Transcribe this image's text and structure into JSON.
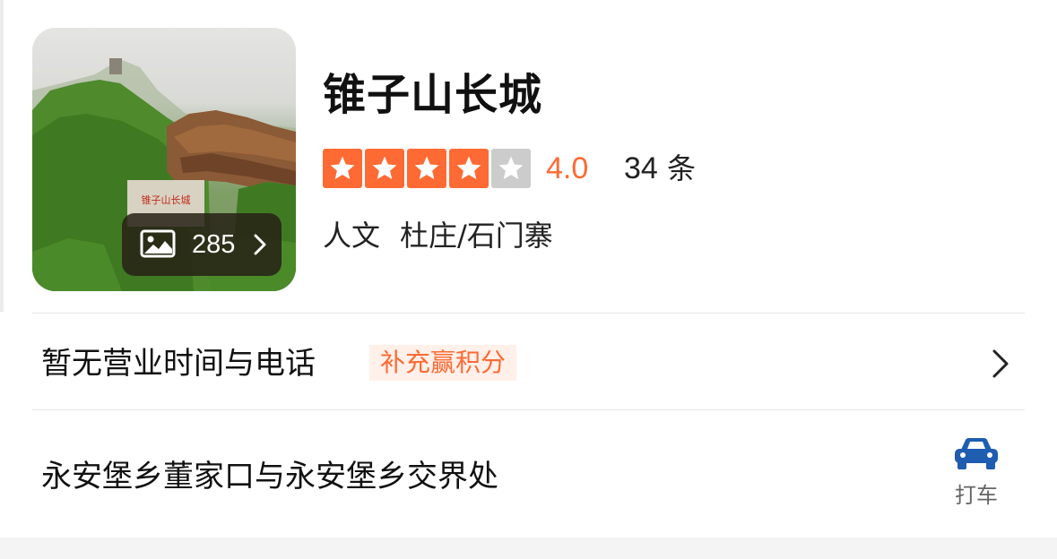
{
  "poi": {
    "title": "锥子山长城",
    "rating": 4.0,
    "score_text": "4.0",
    "review_count": "34",
    "review_unit": "条",
    "category": "人文",
    "area": "杜庄/石门寨",
    "photo_count": "285",
    "photo_sign_text": "锥子山长城"
  },
  "hours_row": {
    "text": "暂无营业时间与电话",
    "tag": "补充赢积分"
  },
  "address_row": {
    "text": "永安堡乡董家口与永安堡乡交界处",
    "taxi_label": "打车"
  },
  "colors": {
    "accent": "#fe6a33",
    "star_off": "#cccccc",
    "tag_bg": "#fff0ea",
    "taxi_icon": "#1e5db0"
  },
  "icons": {
    "photo_badge": "image-icon",
    "photo_chevron": "chevron-right-icon",
    "row_chevron": "chevron-right-icon",
    "taxi": "car-icon",
    "rating": "star-icon"
  }
}
